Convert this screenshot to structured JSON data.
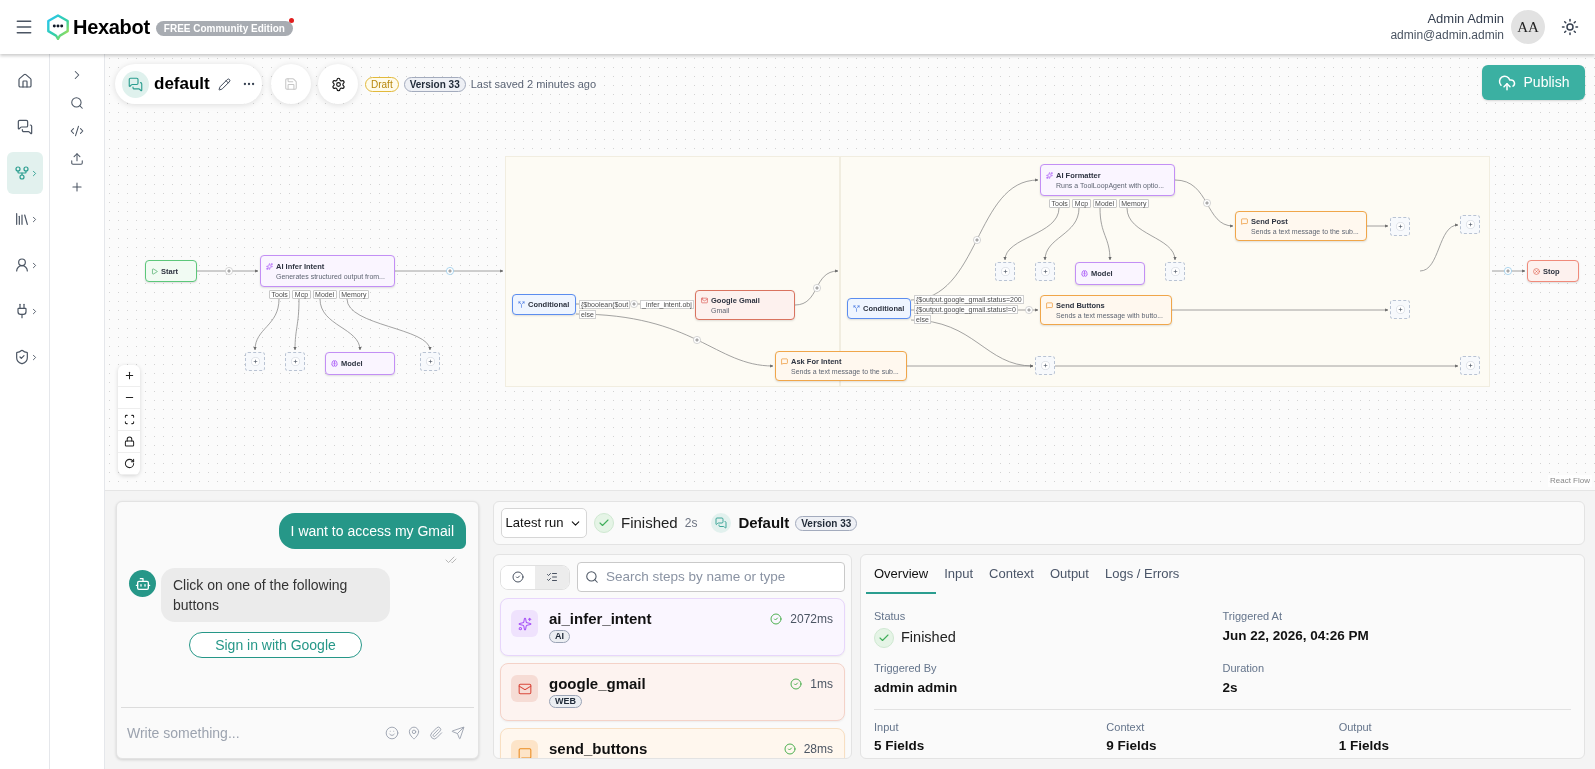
{
  "header": {
    "brand": "Hexabot",
    "edition_badge": {
      "label": "FREE Community Edition",
      "notification": true
    },
    "user": {
      "name": "Admin Admin",
      "email": "admin@admin.admin",
      "initials": "AA"
    }
  },
  "nav_rail": {
    "items": [
      {
        "selected": false,
        "submenu": false
      },
      {
        "selected": false,
        "submenu": false
      },
      {
        "selected": true,
        "submenu": true
      },
      {
        "selected": false,
        "submenu": true
      },
      {
        "selected": false,
        "submenu": true
      },
      {
        "selected": false,
        "submenu": true
      },
      {
        "selected": false,
        "submenu": true
      }
    ]
  },
  "workflow": {
    "name": "default",
    "save_disabled": true,
    "status_badge": "Draft",
    "version_badge": "Version 33",
    "last_saved": "Last saved 2 minutes ago",
    "publish": "Publish"
  },
  "canvas": {
    "nodes": [
      {
        "kind": "start",
        "title": "Start"
      },
      {
        "kind": "ai",
        "title": "AI Infer Intent",
        "subtitle": "Generates structured output from...",
        "ports": [
          "Tools",
          "Mcp",
          "Model",
          "Memory"
        ]
      },
      {
        "kind": "placeholder"
      },
      {
        "kind": "placeholder"
      },
      {
        "kind": "model",
        "title": "Model"
      },
      {
        "kind": "placeholder"
      },
      {
        "kind": "conditional",
        "title": "Conditional",
        "branches": [
          "{$boolean($out",
          "else"
        ]
      },
      {
        "kind": "web",
        "title": "Google Gmail",
        "subtitle": "Gmail"
      },
      {
        "kind": "message",
        "title": "Ask For Intent",
        "subtitle": "Sends a text message to the sub..."
      },
      {
        "kind": "conditional",
        "title": "Conditional",
        "branches": [
          "{$output.google_gmail.status=200",
          "{$output.google_gmail.status!=0",
          "else"
        ]
      },
      {
        "kind": "ai",
        "title": "AI Formatter",
        "subtitle": "Runs a ToolLoopAgent with optio...",
        "ports": [
          "Tools",
          "Mcp",
          "Model",
          "Memory"
        ]
      },
      {
        "kind": "placeholder"
      },
      {
        "kind": "placeholder"
      },
      {
        "kind": "model",
        "title": "Model"
      },
      {
        "kind": "placeholder"
      },
      {
        "kind": "message",
        "title": "Send Post",
        "subtitle": "Sends a text message to the sub..."
      },
      {
        "kind": "message",
        "title": "Send Buttons",
        "subtitle": "Sends a text message with butto..."
      },
      {
        "kind": "placeholder"
      },
      {
        "kind": "placeholder"
      },
      {
        "kind": "placeholder"
      },
      {
        "kind": "placeholder"
      },
      {
        "kind": "placeholder"
      },
      {
        "kind": "stop",
        "title": "Stop"
      }
    ],
    "edge_labels": [
      "_infer_intent.obj"
    ],
    "attribution": "React Flow"
  },
  "chat": {
    "messages": [
      {
        "kind": "user",
        "text": "I want to access my Gmail",
        "read": true
      },
      {
        "kind": "bot",
        "text": "Click on one of the following buttons",
        "buttons": [
          "Sign in with Google"
        ]
      }
    ],
    "input": {
      "placeholder": "Write something..."
    }
  },
  "run": {
    "selector": "Latest run",
    "status": "Finished",
    "succeeded": true,
    "duration": "2s",
    "flow_name": "Default",
    "version": "Version 33"
  },
  "steps": {
    "filters": [
      {
        "selected": false
      },
      {
        "selected": true
      }
    ],
    "search": {
      "placeholder": "Search steps by name or type"
    },
    "items": [
      {
        "name": "ai_infer_intent",
        "kind": "ai",
        "type": "AI",
        "time": "2072ms",
        "succeeded": true
      },
      {
        "name": "google_gmail",
        "kind": "web",
        "type": "WEB",
        "time": "1ms",
        "succeeded": true
      },
      {
        "name": "send_buttons",
        "kind": "message",
        "time": "28ms",
        "succeeded": true
      }
    ]
  },
  "details": {
    "tabs": [
      {
        "label": "Overview",
        "selected": true
      },
      {
        "label": "Input",
        "selected": false
      },
      {
        "label": "Context",
        "selected": false
      },
      {
        "label": "Output",
        "selected": false
      },
      {
        "label": "Logs / Errors",
        "selected": false
      }
    ],
    "fields": [
      {
        "kind": "status",
        "label": "Status",
        "value": "Finished"
      },
      {
        "kind": "text",
        "label": "Triggered At",
        "value": "Jun 22, 2026, 04:26 PM"
      },
      {
        "kind": "text",
        "label": "Triggered By",
        "value": "admin admin"
      },
      {
        "kind": "text",
        "label": "Duration",
        "value": "2s"
      }
    ],
    "summary": [
      {
        "label": "Input",
        "value": "5 Fields"
      },
      {
        "label": "Context",
        "value": "9 Fields"
      },
      {
        "label": "Output",
        "value": "1 Fields"
      }
    ]
  }
}
